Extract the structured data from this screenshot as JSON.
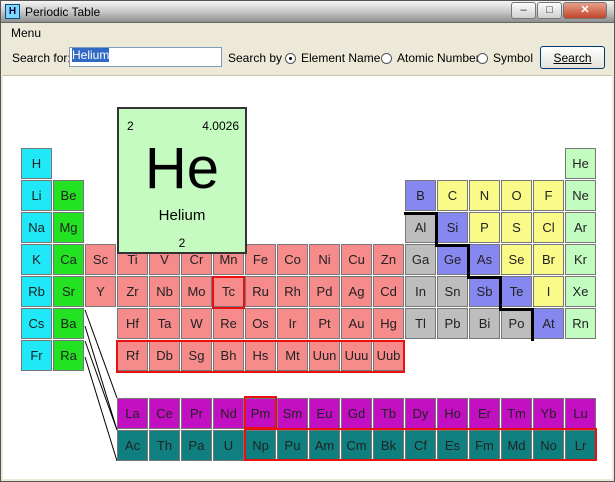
{
  "window": {
    "title": "Periodic Table",
    "app_icon": "H",
    "min_glyph": "–",
    "max_glyph": "□",
    "close_glyph": "✕"
  },
  "menu": {
    "label": "Menu"
  },
  "search": {
    "label": "Search for:",
    "value": "Helium",
    "by_label": "Search by",
    "options": [
      {
        "label": "Element Name",
        "selected": true
      },
      {
        "label": "Atomic Number",
        "selected": false
      },
      {
        "label": "Symbol",
        "selected": false
      }
    ],
    "button": "Search"
  },
  "selected_element": {
    "number": "2",
    "mass": "4.0026",
    "symbol": "He",
    "name": "Helium",
    "footer": "2"
  },
  "colors": {
    "alkali": "#1fe9f9",
    "alkaline": "#22e222",
    "transition": "#f68b8b",
    "post": "#bdbdbd",
    "metalloid": "#8787f0",
    "nonmetal": "#fafa88",
    "noble": "#c2fcc0",
    "lanthanide": "#c20fc2",
    "actinide": "#0f7f7f",
    "highlight": "#e81010"
  },
  "rows": [
    [
      "H",
      null,
      null,
      null,
      null,
      null,
      null,
      null,
      null,
      null,
      null,
      null,
      null,
      null,
      null,
      null,
      null,
      "He"
    ],
    [
      "Li",
      "Be",
      null,
      null,
      null,
      null,
      null,
      null,
      null,
      null,
      null,
      null,
      "B",
      "C",
      "N",
      "O",
      "F",
      "Ne"
    ],
    [
      "Na",
      "Mg",
      null,
      null,
      null,
      null,
      null,
      null,
      null,
      null,
      null,
      null,
      "Al",
      "Si",
      "P",
      "S",
      "Cl",
      "Ar"
    ],
    [
      "K",
      "Ca",
      "Sc",
      "Ti",
      "V",
      "Cr",
      "Mn",
      "Fe",
      "Co",
      "Ni",
      "Cu",
      "Zn",
      "Ga",
      "Ge",
      "As",
      "Se",
      "Br",
      "Kr"
    ],
    [
      "Rb",
      "Sr",
      "Y",
      "Zr",
      "Nb",
      "Mo",
      "Tc",
      "Ru",
      "Rh",
      "Pd",
      "Ag",
      "Cd",
      "In",
      "Sn",
      "Sb",
      "Te",
      "I",
      "Xe"
    ],
    [
      "Cs",
      "Ba",
      null,
      "Hf",
      "Ta",
      "W",
      "Re",
      "Os",
      "Ir",
      "Pt",
      "Au",
      "Hg",
      "Tl",
      "Pb",
      "Bi",
      "Po",
      "At",
      "Rn"
    ],
    [
      "Fr",
      "Ra",
      null,
      "Rf",
      "Db",
      "Sg",
      "Bh",
      "Hs",
      "Mt",
      "Uun",
      "Uuu",
      "Uub",
      null,
      null,
      null,
      null,
      null,
      null
    ]
  ],
  "lanthanides": [
    "La",
    "Ce",
    "Pr",
    "Nd",
    "Pm",
    "Sm",
    "Eu",
    "Gd",
    "Tb",
    "Dy",
    "Ho",
    "Er",
    "Tm",
    "Yb",
    "Lu"
  ],
  "actinides": [
    "Ac",
    "Th",
    "Pa",
    "U",
    "Np",
    "Pu",
    "Am",
    "Cm",
    "Bk",
    "Cf",
    "Es",
    "Fm",
    "Md",
    "No",
    "Lr"
  ]
}
